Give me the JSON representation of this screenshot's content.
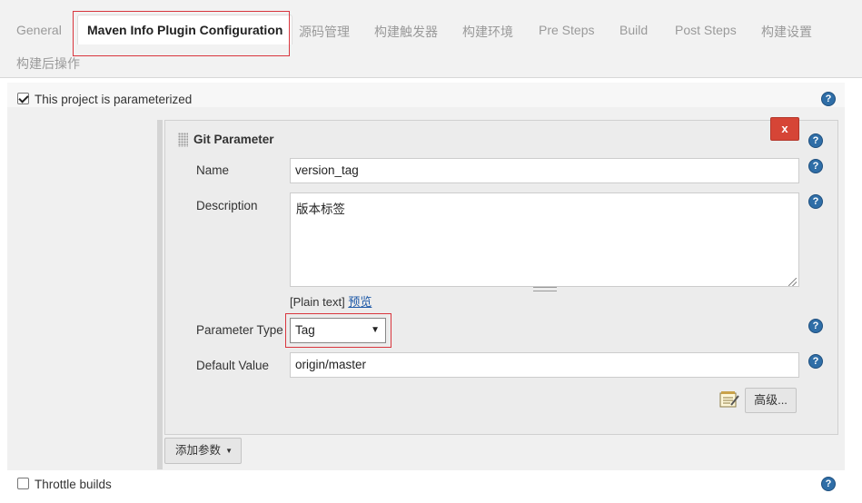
{
  "tabs": [
    {
      "label": "General",
      "active": false
    },
    {
      "label": "Maven Info Plugin Configuration",
      "active": true
    },
    {
      "label": "源码管理",
      "active": false
    },
    {
      "label": "构建触发器",
      "active": false
    },
    {
      "label": "构建环境",
      "active": false
    },
    {
      "label": "Pre Steps",
      "active": false
    },
    {
      "label": "Build",
      "active": false
    },
    {
      "label": "Post Steps",
      "active": false
    },
    {
      "label": "构建设置",
      "active": false
    },
    {
      "label": "构建后操作",
      "active": false
    }
  ],
  "parameterized": {
    "label": "This project is parameterized",
    "checked": true
  },
  "git_parameter": {
    "title": "Git Parameter",
    "delete_label": "x",
    "name": {
      "label": "Name",
      "value": "version_tag"
    },
    "description": {
      "label": "Description",
      "value": "版本标签",
      "plain_text": "[Plain text]",
      "preview_link": "预览"
    },
    "parameter_type": {
      "label": "Parameter Type",
      "selected": "Tag"
    },
    "default_value": {
      "label": "Default Value",
      "value": "origin/master"
    },
    "advanced_label": "高级..."
  },
  "add_parameter_label": "添加参数",
  "throttle": {
    "label": "Throttle builds",
    "checked": false
  },
  "help_glyph": "?",
  "colors": {
    "accent": "#2f6ea7",
    "highlight": "#d9363e",
    "delete": "#d64536"
  }
}
